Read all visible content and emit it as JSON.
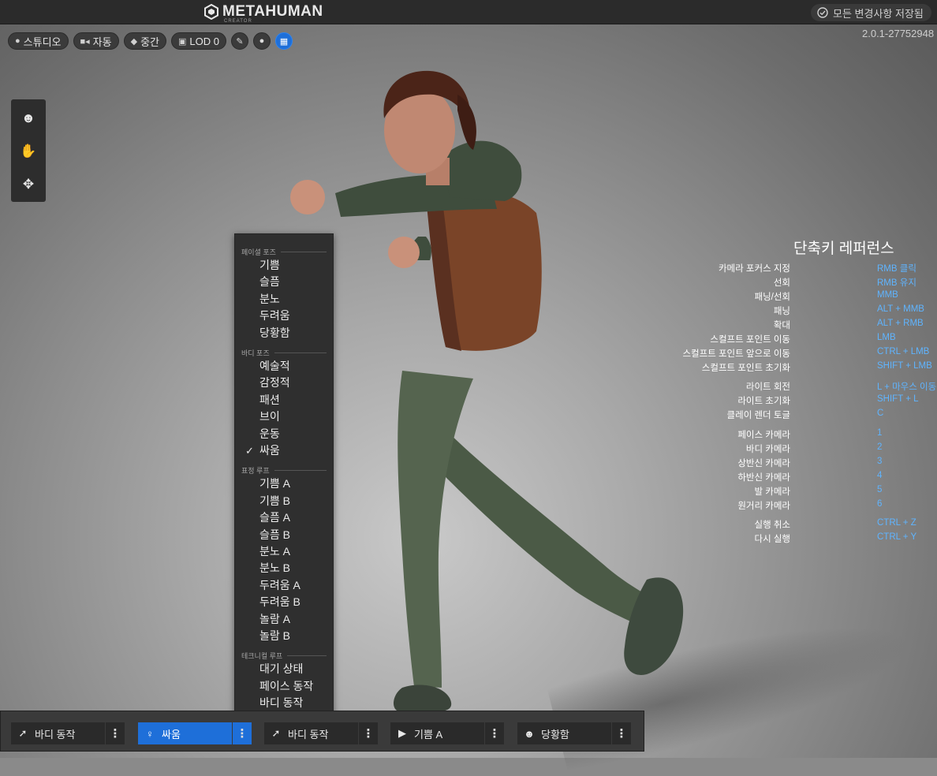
{
  "app": {
    "logo_text": "METAHUMAN",
    "logo_subtext": "CREATOR",
    "save_status": "모든 변경사항 저장됨",
    "version": "2.0.1-27752948"
  },
  "toolbar": {
    "lighting_label": "스튜디오",
    "camera_label": "자동",
    "quality_label": "중간",
    "lod_label": "LOD 0"
  },
  "pose_menu": {
    "sections": [
      {
        "title": "페이셜 포즈",
        "items": [
          "기쁨",
          "슬픔",
          "분노",
          "두려움",
          "당황함"
        ]
      },
      {
        "title": "바디 포즈",
        "items": [
          "예술적",
          "감정적",
          "패션",
          "브이",
          "운동",
          "싸움"
        ]
      },
      {
        "title": "표정 루프",
        "items": [
          "기쁨 A",
          "기쁨 B",
          "슬픔 A",
          "슬픔 B",
          "분노 A",
          "분노 B",
          "두려움 A",
          "두려움 B",
          "놀람 A",
          "놀람 B"
        ]
      },
      {
        "title": "테크니컬 루프",
        "items": [
          "대기 상태",
          "페이스 동작",
          "바디 동작"
        ]
      }
    ],
    "selected": "싸움"
  },
  "shortcuts": {
    "title": "단축키 레퍼런스",
    "rows": [
      {
        "label": "카메라 포커스 지정",
        "key": "RMB 클릭"
      },
      {
        "label": "선회",
        "key": "RMB 유지"
      },
      {
        "label": "패닝/선회",
        "key": "MMB"
      },
      {
        "label": "패닝",
        "key": "ALT + MMB"
      },
      {
        "label": "확대",
        "key": "ALT + RMB"
      },
      {
        "label": "스컬프트 포인트 이동",
        "key": "LMB"
      },
      {
        "label": "스컬프트 포인트 앞으로 이동",
        "key": "CTRL + LMB"
      },
      {
        "label": "스컬프트 포인트 초기화",
        "key": "SHIFT + LMB"
      },
      {
        "label": "라이트 회전",
        "key": "L + 마우스 이동"
      },
      {
        "label": "라이트 초기화",
        "key": "SHIFT + L"
      },
      {
        "label": "클레이 렌더 토글",
        "key": "C"
      },
      {
        "label": "페이스 카메라",
        "key": "1"
      },
      {
        "label": "바디 카메라",
        "key": "2"
      },
      {
        "label": "상반신 카메라",
        "key": "3"
      },
      {
        "label": "하반신 카메라",
        "key": "4"
      },
      {
        "label": "발 카메라",
        "key": "5"
      },
      {
        "label": "원거리 카메라",
        "key": "6"
      },
      {
        "label": "실행 취소",
        "key": "CTRL + Z"
      },
      {
        "label": "다시 실행",
        "key": "CTRL + Y"
      }
    ]
  },
  "bottom_bar": {
    "slots": [
      {
        "label": "바디 동작",
        "icon": "running-figure-icon",
        "active": false
      },
      {
        "label": "싸움",
        "icon": "standing-figure-icon",
        "active": true
      },
      {
        "label": "바디 동작",
        "icon": "running-figure-icon",
        "active": false
      },
      {
        "label": "기쁨 A",
        "icon": "play-circle-icon",
        "active": false
      },
      {
        "label": "당황함",
        "icon": "face-icon",
        "active": false
      }
    ]
  },
  "colors": {
    "accent": "#1e6fd9",
    "shortcut_key": "#5fb4ff",
    "topbar": "#2b2b2b"
  }
}
